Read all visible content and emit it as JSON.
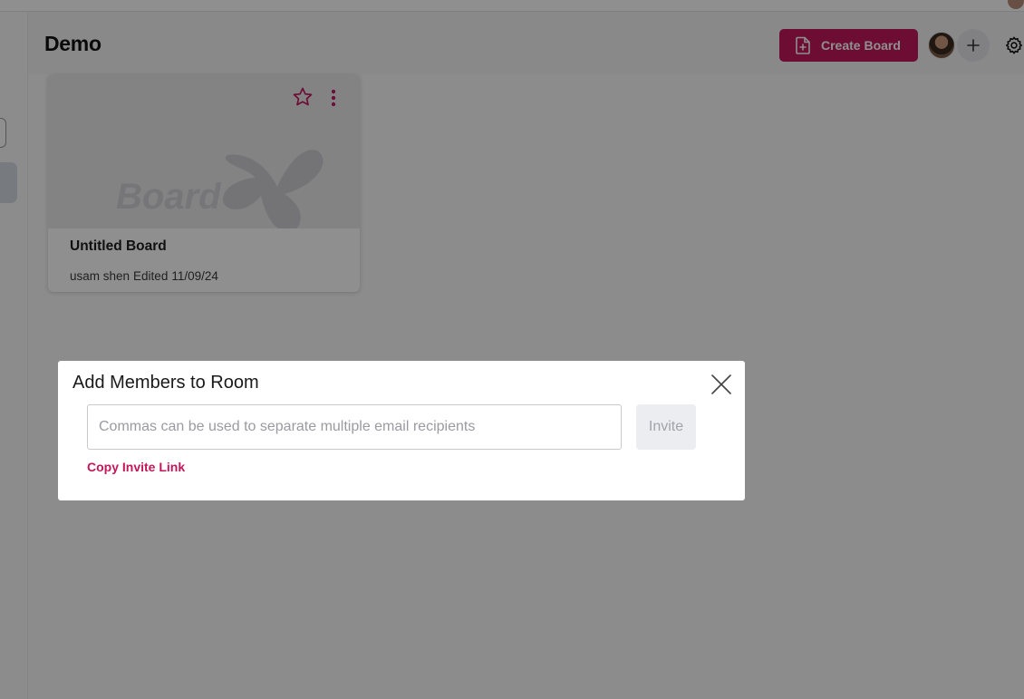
{
  "header": {
    "title": "Demo",
    "create_board_label": "Create Board"
  },
  "boards": [
    {
      "title": "Untitled Board",
      "author": "usam shen",
      "edited_label": "Edited",
      "edited_date": "11/09/24",
      "thumbnail_text": "Board"
    }
  ],
  "modal": {
    "title": "Add Members to Room",
    "email_placeholder": "Commas can be used to separate multiple email recipients",
    "email_value": "",
    "invite_label": "Invite",
    "copy_link_label": "Copy Invite Link"
  },
  "colors": {
    "accent": "#c2185b",
    "overlay": "rgba(0,0,0,0.44)",
    "invite_disabled_bg": "#ebedf0"
  },
  "icons": {
    "create_board": "file-plus-icon",
    "add_member": "plus-icon",
    "settings": "gear-icon",
    "favorite": "star-icon",
    "card_menu": "kebab-menu-icon",
    "close": "close-icon"
  }
}
